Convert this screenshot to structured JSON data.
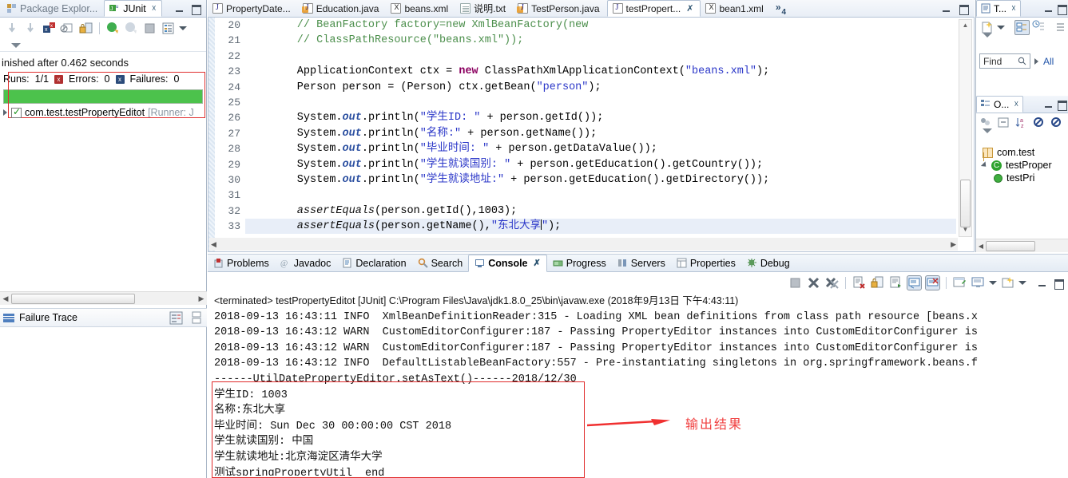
{
  "junit": {
    "tab_inactive": "Package Explor...",
    "tab_active": "JUnit",
    "status": "inished after 0.462 seconds",
    "runs_label": "Runs:",
    "runs_value": "1/1",
    "errors_label": "Errors:",
    "errors_value": "0",
    "failures_label": "Failures:",
    "failures_value": "0",
    "progress_percent": "100",
    "progress_color": "#4cc24c",
    "tree_item": "com.test.testPropertyEditot",
    "tree_item_suffix": "[Runner: J",
    "failure_trace_label": "Failure Trace"
  },
  "editor": {
    "tabs": [
      {
        "label": "PropertyDate...",
        "icon": "java-file-icon",
        "active": false,
        "warn": false,
        "closable": false
      },
      {
        "label": "Education.java",
        "icon": "java-file-icon",
        "active": false,
        "warn": true,
        "closable": false
      },
      {
        "label": "beans.xml",
        "icon": "xml-file-icon",
        "active": false,
        "warn": false,
        "closable": false
      },
      {
        "label": "说明.txt",
        "icon": "text-file-icon",
        "active": false,
        "warn": false,
        "closable": false
      },
      {
        "label": "TestPerson.java",
        "icon": "java-file-icon",
        "active": false,
        "warn": true,
        "closable": false
      },
      {
        "label": "testPropert...",
        "icon": "java-file-icon",
        "active": true,
        "warn": false,
        "closable": true
      },
      {
        "label": "bean1.xml",
        "icon": "xml-file-icon",
        "active": false,
        "warn": false,
        "closable": false
      }
    ],
    "overflow_label": "»",
    "overflow_count": "4",
    "lines": [
      {
        "n": "20",
        "tokens": [
          {
            "t": "        // BeanFactory factory=new XmlBeanFactory(new",
            "c": "k-cmt"
          }
        ]
      },
      {
        "n": "21",
        "tokens": [
          {
            "t": "        // ClassPathResource(\"beans.xml\"));",
            "c": "k-cmt"
          }
        ]
      },
      {
        "n": "22",
        "tokens": [
          {
            "t": "",
            "c": ""
          }
        ]
      },
      {
        "n": "23",
        "tokens": [
          {
            "t": "        ApplicationContext ctx = ",
            "c": ""
          },
          {
            "t": "new",
            "c": "k-kw"
          },
          {
            "t": " ClassPathXmlApplicationContext(",
            "c": ""
          },
          {
            "t": "\"beans.xml\"",
            "c": "k-str"
          },
          {
            "t": ");",
            "c": ""
          }
        ]
      },
      {
        "n": "24",
        "tokens": [
          {
            "t": "        Person person = (Person) ctx.getBean(",
            "c": ""
          },
          {
            "t": "\"person\"",
            "c": "k-str"
          },
          {
            "t": ");",
            "c": ""
          }
        ]
      },
      {
        "n": "25",
        "tokens": [
          {
            "t": "",
            "c": ""
          }
        ]
      },
      {
        "n": "26",
        "tokens": [
          {
            "t": "        System.",
            "c": ""
          },
          {
            "t": "out",
            "c": "k-fld"
          },
          {
            "t": ".println(",
            "c": ""
          },
          {
            "t": "\"学生ID: \"",
            "c": "k-str"
          },
          {
            "t": " + person.getId());",
            "c": ""
          }
        ]
      },
      {
        "n": "27",
        "tokens": [
          {
            "t": "        System.",
            "c": ""
          },
          {
            "t": "out",
            "c": "k-fld"
          },
          {
            "t": ".println(",
            "c": ""
          },
          {
            "t": "\"名称:\"",
            "c": "k-str"
          },
          {
            "t": " + person.getName());",
            "c": ""
          }
        ]
      },
      {
        "n": "28",
        "tokens": [
          {
            "t": "        System.",
            "c": ""
          },
          {
            "t": "out",
            "c": "k-fld"
          },
          {
            "t": ".println(",
            "c": ""
          },
          {
            "t": "\"毕业时间: \"",
            "c": "k-str"
          },
          {
            "t": " + person.getDataValue());",
            "c": ""
          }
        ]
      },
      {
        "n": "29",
        "tokens": [
          {
            "t": "        System.",
            "c": ""
          },
          {
            "t": "out",
            "c": "k-fld"
          },
          {
            "t": ".println(",
            "c": ""
          },
          {
            "t": "\"学生就读国别: \"",
            "c": "k-str"
          },
          {
            "t": " + person.getEducation().getCountry());",
            "c": ""
          }
        ]
      },
      {
        "n": "30",
        "tokens": [
          {
            "t": "        System.",
            "c": ""
          },
          {
            "t": "out",
            "c": "k-fld"
          },
          {
            "t": ".println(",
            "c": ""
          },
          {
            "t": "\"学生就读地址:\"",
            "c": "k-str"
          },
          {
            "t": " + person.getEducation().getDirectory());",
            "c": ""
          }
        ]
      },
      {
        "n": "31",
        "tokens": [
          {
            "t": "",
            "c": ""
          }
        ]
      },
      {
        "n": "32",
        "tokens": [
          {
            "t": "        assertEquals",
            "c": "k-stat"
          },
          {
            "t": "(person.getId(),1003);",
            "c": ""
          }
        ]
      },
      {
        "n": "33",
        "tokens": [
          {
            "t": "        assertEquals",
            "c": "k-stat"
          },
          {
            "t": "(person.getName(),",
            "c": ""
          },
          {
            "t": "\"东北大享",
            "c": "k-str"
          },
          {
            "t": "\"",
            "c": "k-str"
          },
          {
            "t": ");",
            "c": ""
          }
        ]
      }
    ]
  },
  "console": {
    "tabs": [
      {
        "label": "Problems",
        "icon": "problems-icon",
        "active": false,
        "closable": false
      },
      {
        "label": "Javadoc",
        "icon": "javadoc-icon",
        "active": false,
        "closable": false
      },
      {
        "label": "Declaration",
        "icon": "declaration-icon",
        "active": false,
        "closable": false
      },
      {
        "label": "Search",
        "icon": "search-icon",
        "active": false,
        "closable": false
      },
      {
        "label": "Console",
        "icon": "console-icon",
        "active": true,
        "closable": true
      },
      {
        "label": "Progress",
        "icon": "progress-icon",
        "active": false,
        "closable": false
      },
      {
        "label": "Servers",
        "icon": "servers-icon",
        "active": false,
        "closable": false
      },
      {
        "label": "Properties",
        "icon": "properties-icon",
        "active": false,
        "closable": false
      },
      {
        "label": "Debug",
        "icon": "debug-icon",
        "active": false,
        "closable": false
      }
    ],
    "header": "<terminated> testPropertyEditot [JUnit] C:\\Program Files\\Java\\jdk1.8.0_25\\bin\\javaw.exe (2018年9月13日 下午4:43:11)",
    "log_lines": [
      "2018-09-13 16:43:11 INFO  XmlBeanDefinitionReader:315 - Loading XML bean definitions from class path resource [beans.x",
      "2018-09-13 16:43:12 WARN  CustomEditorConfigurer:187 - Passing PropertyEditor instances into CustomEditorConfigurer is",
      "2018-09-13 16:43:12 WARN  CustomEditorConfigurer:187 - Passing PropertyEditor instances into CustomEditorConfigurer is",
      "2018-09-13 16:43:12 INFO  DefaultListableBeanFactory:557 - Pre-instantiating singletons in org.springframework.beans.f"
    ],
    "output_lines": [
      "------UtilDatePropertyEditor.setAsText()------2018/12/30",
      "学生ID: 1003",
      "名称:东北大享",
      "毕业时间: Sun Dec 30 00:00:00 CST 2018",
      "学生就读国别: 中国",
      "学生就读地址:北京海淀区清华大学",
      "测试springPropertyUtil  end"
    ],
    "annotation_text": "输出结果",
    "annotation_color": "#f04040",
    "highlight_box_color": "#e02a2a"
  },
  "right_views": {
    "tasklist_tab": "T...",
    "find_placeholder": "Find",
    "all_label": "All",
    "outline_tab": "O...",
    "outline_items": [
      {
        "label": "com.test",
        "icon": "package-icon",
        "indent": 0
      },
      {
        "label": "testProper",
        "icon": "class-icon",
        "indent": 0
      },
      {
        "label": "testPri",
        "icon": "method-icon",
        "indent": 1
      }
    ]
  }
}
